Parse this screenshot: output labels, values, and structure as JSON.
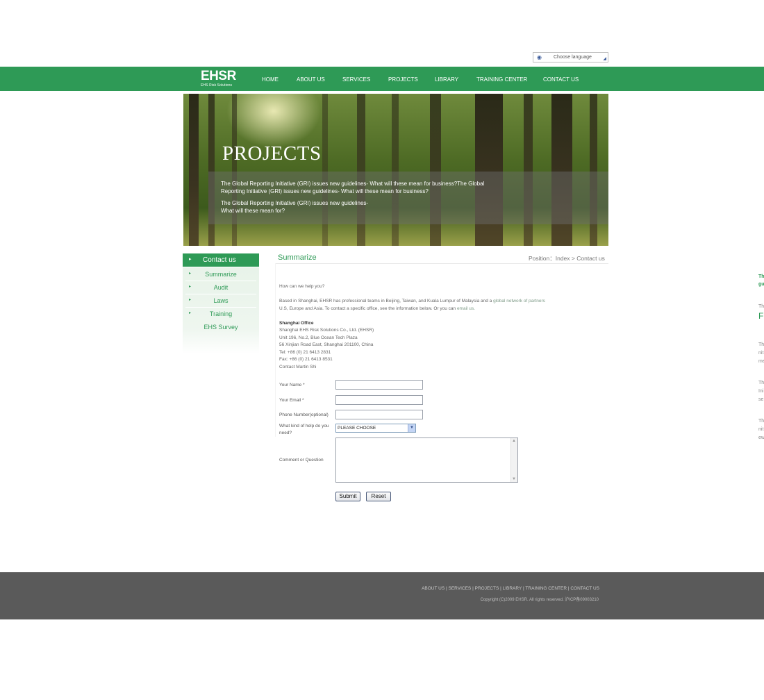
{
  "language": {
    "label": "Choose language"
  },
  "logo": {
    "mark": "EHSR",
    "subtitle": "EHS Risk Solutions"
  },
  "nav": [
    "HOME",
    "ABOUT US",
    "SERVICES",
    "PROJECTS",
    "LIBRARY",
    "TRAINING CENTER",
    "CONTACT US"
  ],
  "hero": {
    "title": "PROJECTS",
    "line1": "The Global Reporting Initiative (GRI) issues new guidelines- What will these mean for business?The Global",
    "line2": "Reporting Initiative (GRI) issues new guidelines- What will these mean for business?",
    "line3": "The Global Reporting Initiative (GRI) issues new guidelines-",
    "line4": "What will these mean for?"
  },
  "sidebar": {
    "header": "Contact us",
    "items": [
      "Summarize",
      "Audit",
      "Laws",
      "Training",
      "EHS Survey"
    ]
  },
  "content": {
    "title": "Summarize",
    "position": "Position：Index > Contact us",
    "question": "How can we help you?",
    "intro1_a": "Based in Shanghai, EHSR has professional teams in Beijing, Taiwan, and Kuala Lumpur of Malaysia and a ",
    "intro1_link": "global network of partners",
    "intro2_a": "U.S, Europe and Asia. To contact a specific office, see the information below. Or you can ",
    "intro2_link": "email us.",
    "office_title": "Shanghai Office",
    "office_lines": [
      "Shanghai EHS Risk Solutions Co., Ltd. (EHSR)",
      "Unit 196, No.2, Blue Ocean Tech Plaza",
      "56 Xinjian Road East, Shanghai 201100, China",
      "Tel: +86 (0) 21 6413 2831",
      "Fax: +86 (0) 21 6413 8531",
      "Contact Martin Shi"
    ]
  },
  "form": {
    "name_label": "Your Name *",
    "email_label": "Your Email *",
    "phone_label": "Phone Number(optional)",
    "help_label_1": "What kind of help do you",
    "help_label_2": "need?",
    "help_value": "PLEASE CHOOSE",
    "comment_label": "Comment or Question",
    "submit": "Submit",
    "reset": "Reset"
  },
  "teasers": [
    "Th",
    "gu",
    "Th",
    "F",
    "Th",
    "nit",
    "me",
    "Th",
    "Ini",
    "se",
    "Th",
    "nit",
    "ew"
  ],
  "footer": {
    "links": [
      "ABOUT US",
      "SERVICES",
      "PROJECTS",
      "LIBRARY",
      "TRAINING CENTER",
      "CONTACT US"
    ],
    "sep": "|",
    "copyright": "Copyright (C)2009 EHSR. All rights reserved. 沪ICP备09003210"
  }
}
